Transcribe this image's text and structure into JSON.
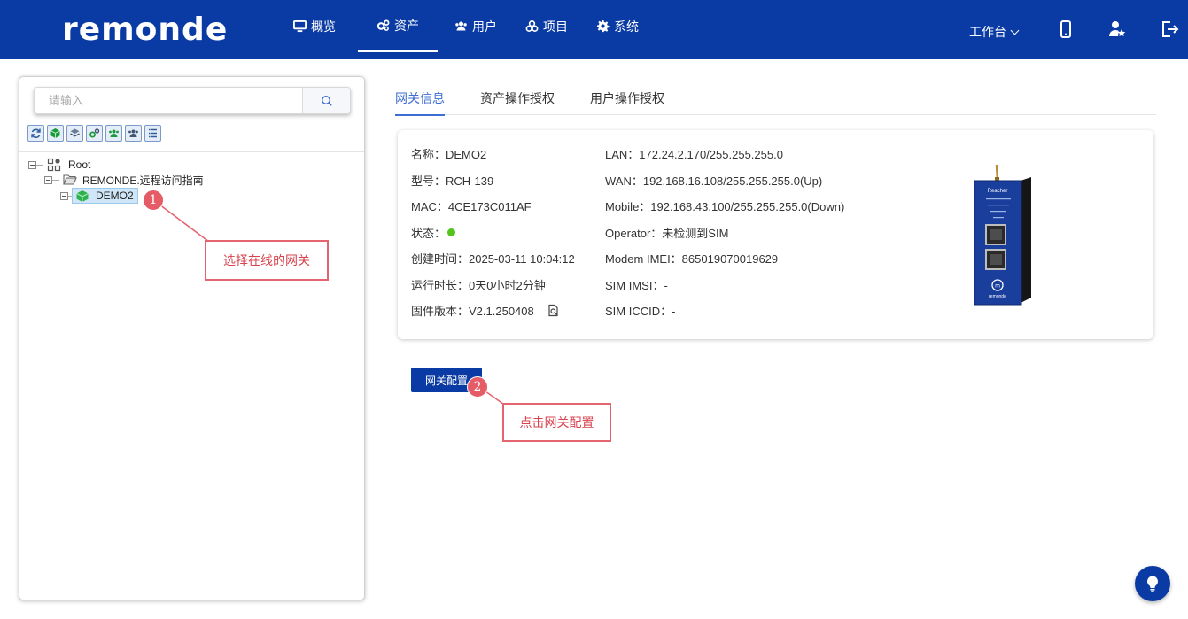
{
  "header": {
    "logo": "remonde",
    "nav": [
      {
        "label": "概览",
        "icon": "monitor-icon"
      },
      {
        "label": "资产",
        "icon": "gears-icon"
      },
      {
        "label": "用户",
        "icon": "users-icon"
      },
      {
        "label": "项目",
        "icon": "cubes-icon"
      },
      {
        "label": "系统",
        "icon": "gear-icon"
      }
    ],
    "active_nav": "资产",
    "workbench": "工作台"
  },
  "sidebar": {
    "search_placeholder": "请输入",
    "tree": {
      "root": "Root",
      "folder": "REMONDE.远程访问指南",
      "gateway": "DEMO2"
    }
  },
  "annotations": {
    "step1_number": "1",
    "step1_text": "选择在线的网关",
    "step2_number": "2",
    "step2_text": "点击网关配置"
  },
  "tabs": [
    "网关信息",
    "资产操作授权",
    "用户操作授权"
  ],
  "gateway_info": {
    "name": "名称：DEMO2",
    "model": "型号：RCH-139",
    "mac": "MAC：4CE173C011AF",
    "status_label": "状态：",
    "status_color": "#52c41a",
    "created": "创建时间：2025-03-11 10:04:12",
    "uptime": "运行时长：0天0小时2分钟",
    "firmware": "固件版本：V2.1.250408",
    "lan": "LAN：172.24.2.170/255.255.255.0",
    "wan": "WAN：192.168.16.108/255.255.255.0(Up)",
    "mobile": "Mobile：192.168.43.100/255.255.255.0(Down)",
    "operator": "Operator：未检测到SIM",
    "imei": "Modem IMEI：865019070019629",
    "imsi": "SIM IMSI：-",
    "iccid": "SIM ICCID：-"
  },
  "device_image": {
    "brand": "remonde",
    "model_text": "Reacher"
  },
  "buttons": {
    "gateway_config": "网关配置"
  },
  "colors": {
    "brand": "#0a3aa3",
    "accent": "#3d6ed1",
    "annotation": "#e55b66"
  }
}
